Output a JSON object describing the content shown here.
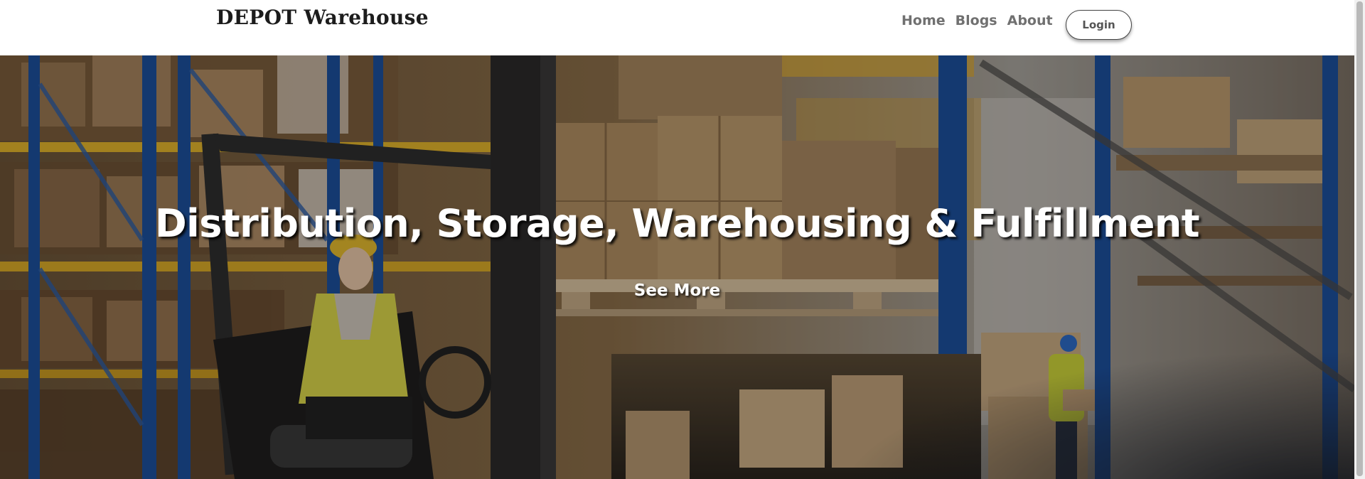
{
  "brand": {
    "name": "DEPOT Warehouse"
  },
  "nav": {
    "links": [
      "Home",
      "Blogs",
      "About"
    ],
    "login_label": "Login"
  },
  "hero": {
    "title": "Distribution, Storage, Warehousing & Fulfillment",
    "cta_label": "See More",
    "background": "warehouse-forklift-photo"
  },
  "colors": {
    "brand_text": "#1c1c1c",
    "nav_text": "#707070",
    "hero_text": "#ffffff",
    "rack_blue": "#1d4f9c",
    "rack_yellow": "#e1b32c",
    "box_cardboard": "#b8956a"
  }
}
